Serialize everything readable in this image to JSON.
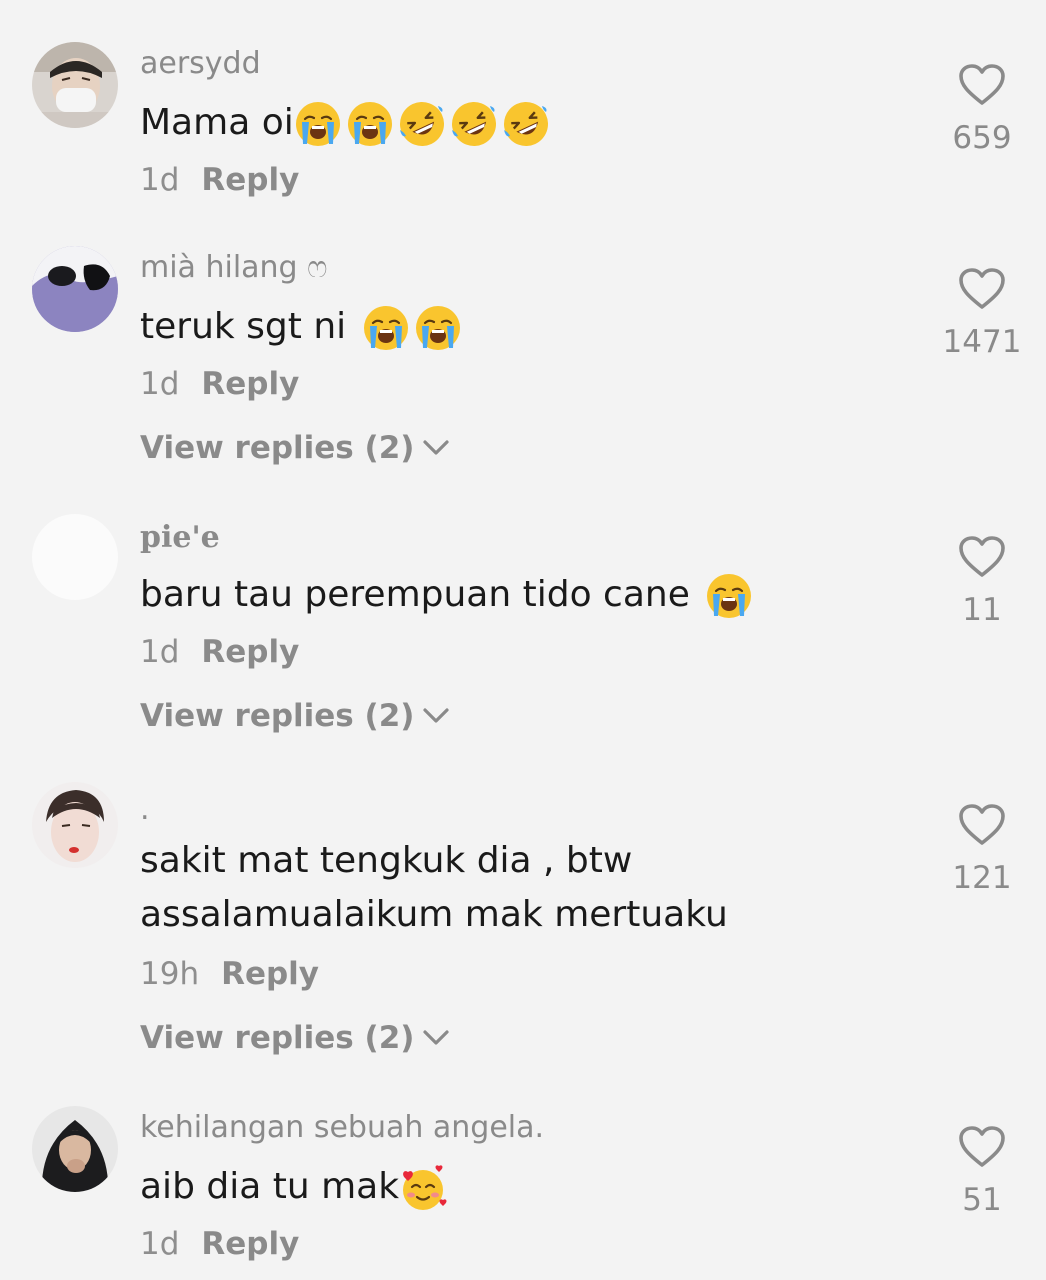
{
  "comments": [
    {
      "username": "aersydd",
      "text": "Mama oi",
      "emojis": [
        "loudly-crying-face-icon",
        "loudly-crying-face-icon",
        "rofl-face-icon",
        "rofl-face-icon",
        "rofl-face-icon"
      ],
      "time": "1d",
      "reply_label": "Reply",
      "likes": "659"
    },
    {
      "username": "mià hilang ෆ",
      "text": "teruk sgt ni ",
      "emojis": [
        "loudly-crying-face-icon",
        "loudly-crying-face-icon"
      ],
      "time": "1d",
      "reply_label": "Reply",
      "likes": "1471",
      "view_replies": "View replies (2)"
    },
    {
      "username": "pie'e",
      "text": "baru tau perempuan tido cane ",
      "emojis": [
        "loudly-crying-face-icon"
      ],
      "time": "1d",
      "reply_label": "Reply",
      "likes": "11",
      "view_replies": "View replies (2)"
    },
    {
      "username": ".",
      "text_line1": "sakit mat tengkuk dia , btw",
      "text_line2": "assalamualaikum mak mertuaku",
      "time": "19h",
      "reply_label": "Reply",
      "likes": "121",
      "view_replies": "View replies (2)"
    },
    {
      "username": "kehilangan sebuah angela.",
      "text": "aib dia tu mak",
      "emojis": [
        "smiling-face-with-hearts-icon"
      ],
      "time": "1d",
      "reply_label": "Reply",
      "likes": "51"
    }
  ],
  "colors": {
    "background": "#f3f3f3",
    "text": "#1a1a1a",
    "muted": "#8a8a8a"
  }
}
